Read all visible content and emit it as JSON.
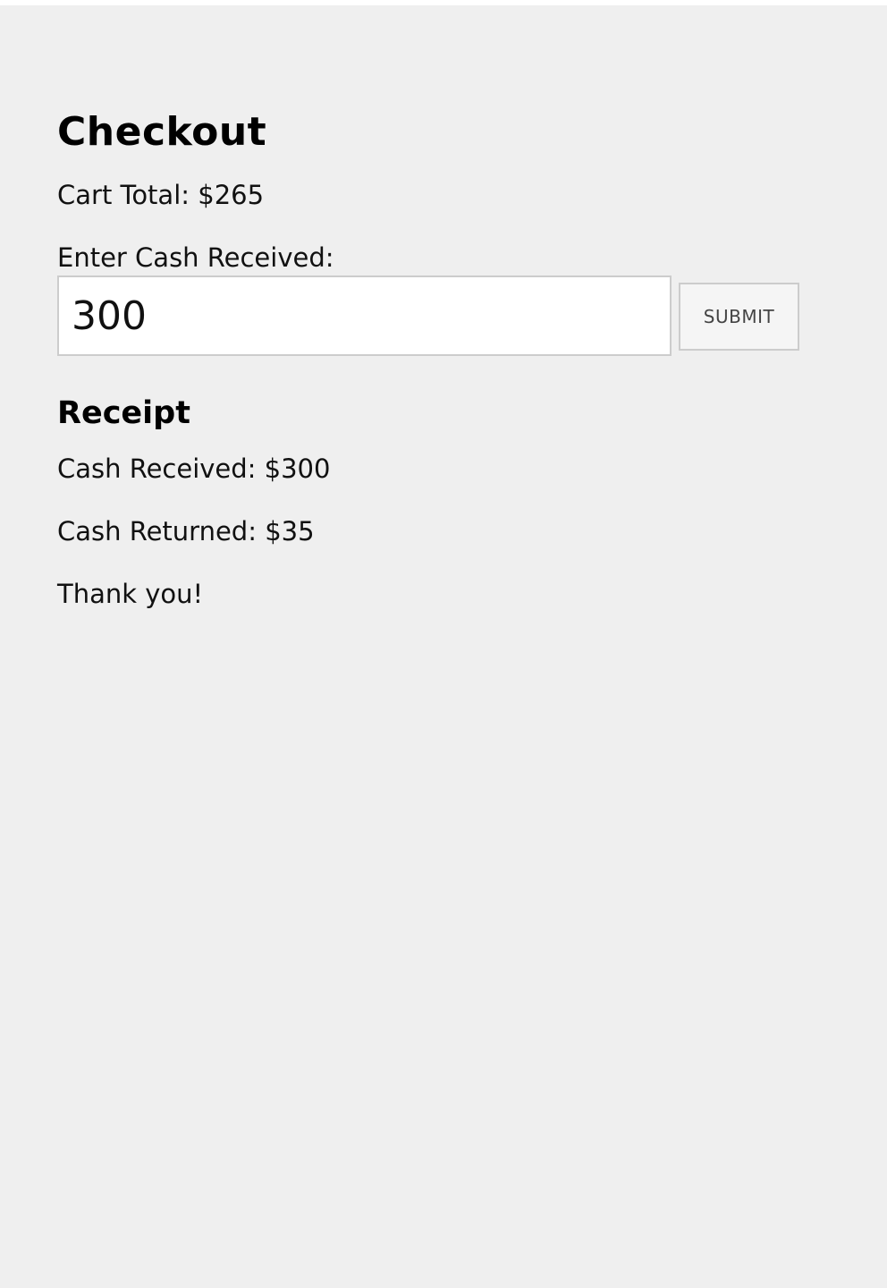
{
  "checkout": {
    "title": "Checkout",
    "cart_total": "Cart Total: $265",
    "cash_label": "Enter Cash Received:",
    "cash_input_value": "300",
    "submit_label": "SUBMIT"
  },
  "receipt": {
    "title": "Receipt",
    "cash_received": "Cash Received: $300",
    "cash_returned": "Cash Returned: $35",
    "thank_you": "Thank you!"
  },
  "colors": {
    "page_background": "#efefef",
    "input_border": "#cccccc",
    "button_background": "#f5f5f5"
  }
}
